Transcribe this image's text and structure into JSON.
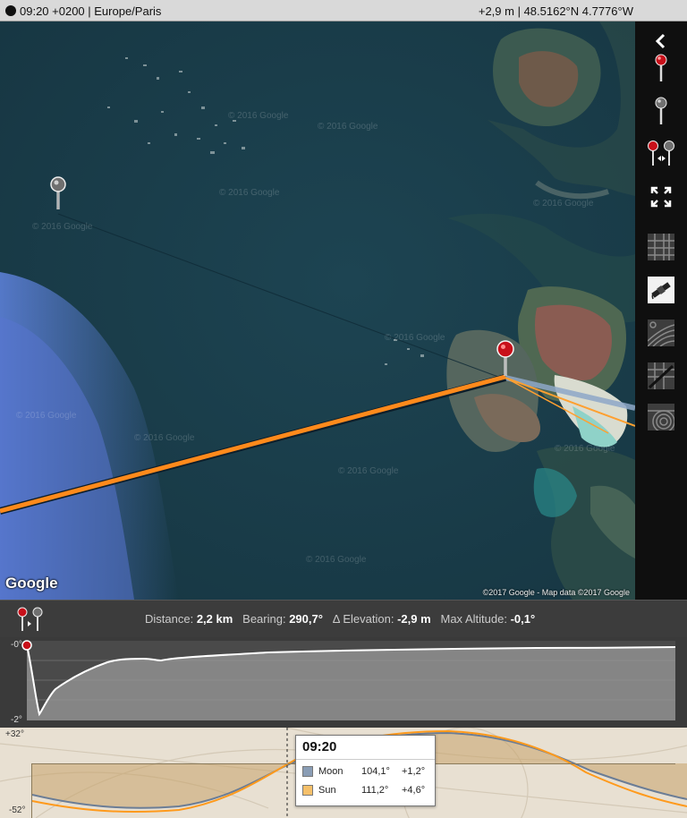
{
  "topbar": {
    "time_zone": "09:20 +0200 | Europe/Paris",
    "elevation_coords": "+2,9 m | 48.5162°N 4.7776°W"
  },
  "map": {
    "provider_logo": "Google",
    "attribution": "©2017 Google - Map data ©2017 Google",
    "watermark": "© 2016 Google"
  },
  "toolbar": {
    "icons": [
      "collapse-chevron-icon",
      "red-pin-icon",
      "grey-pin-icon",
      "pin-pair-swap-icon",
      "fullscreen-icon",
      "map-grid-layer-icon",
      "satellite-layer-icon",
      "terrain-layer-icon",
      "hybrid-layer-icon",
      "relief-layer-icon"
    ]
  },
  "infobar": {
    "distance_label": "Distance:",
    "distance_value": "2,2 km",
    "bearing_label": "Bearing:",
    "bearing_value": "290,7°",
    "elevation_label": "Δ Elevation:",
    "elevation_value": "-2,9 m",
    "max_alt_label": "Max Altitude:",
    "max_alt_value": "-0,1°"
  },
  "profile": {
    "y_top": "-0°",
    "y_bottom": "-2°"
  },
  "sunmoon": {
    "y_top": "+32°",
    "y_bottom": "-52°",
    "tooltip": {
      "time": "09:20",
      "moon": {
        "name": "Moon",
        "azimuth": "104,1°",
        "altitude": "+1,2°",
        "color": "#8a9db5"
      },
      "sun": {
        "name": "Sun",
        "azimuth": "111,2°",
        "altitude": "+4,6°",
        "color": "#f5c06a"
      }
    }
  },
  "colors": {
    "sun_line": "#ff8a1c",
    "moon_line": "#8ea8c8",
    "accent_pin": "#c8101a"
  }
}
